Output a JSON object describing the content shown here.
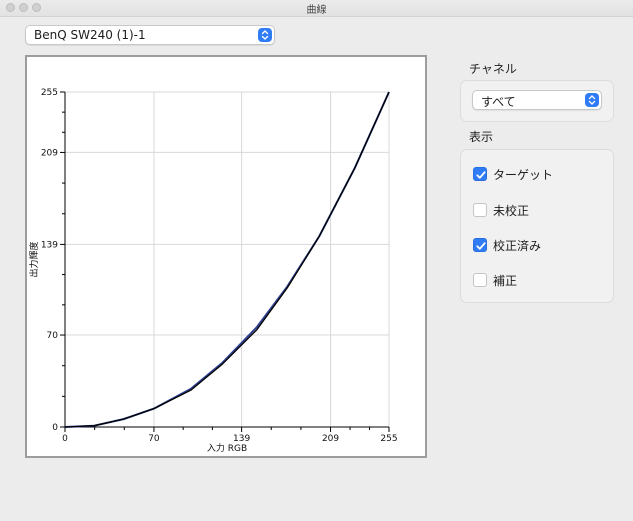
{
  "window": {
    "title": "曲線"
  },
  "device_select": {
    "value": "BenQ SW240 (1)-1"
  },
  "channel": {
    "heading": "チャネル",
    "value": "すべて"
  },
  "display": {
    "heading": "表示",
    "options": [
      {
        "label": "ターゲット",
        "checked": true
      },
      {
        "label": "未校正",
        "checked": false
      },
      {
        "label": "校正済み",
        "checked": true
      },
      {
        "label": "補正",
        "checked": false
      }
    ]
  },
  "chart_data": {
    "type": "line",
    "xlabel": "入力 RGB",
    "ylabel": "出力輝度",
    "xlim": [
      0,
      255
    ],
    "ylim": [
      0,
      255
    ],
    "xticks": [
      0,
      70,
      139,
      209,
      255
    ],
    "yticks": [
      0,
      70,
      139,
      209,
      255
    ],
    "grid": true,
    "series": [
      {
        "color": "#000000",
        "x": [
          0,
          23,
          46,
          70,
          99,
          124,
          151,
          175,
          200,
          228,
          255
        ],
        "y": [
          0,
          1,
          6,
          14,
          28,
          48,
          74,
          106,
          145,
          197,
          255
        ]
      },
      {
        "color": "#2b3f8c",
        "x": [
          0,
          23,
          46,
          70,
          99,
          124,
          151,
          175,
          200,
          228,
          255
        ],
        "y": [
          0,
          1,
          6,
          14,
          29,
          49,
          76,
          107,
          145,
          197,
          255
        ]
      }
    ]
  }
}
